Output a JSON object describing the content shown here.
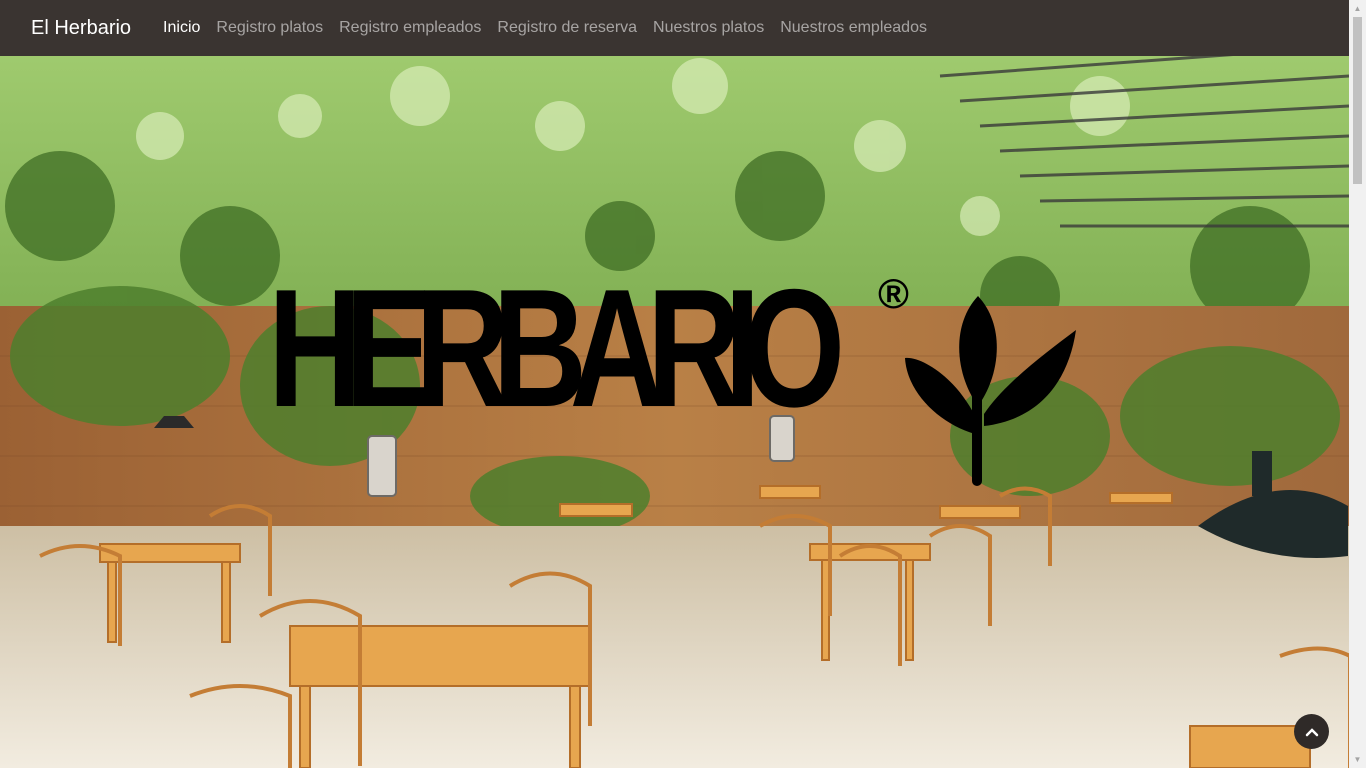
{
  "navbar": {
    "brand": "El Herbario",
    "links": [
      {
        "label": "Inicio",
        "active": true
      },
      {
        "label": "Registro platos",
        "active": false
      },
      {
        "label": "Registro empleados",
        "active": false
      },
      {
        "label": "Registro de reserva",
        "active": false
      },
      {
        "label": "Nuestros platos",
        "active": false
      },
      {
        "label": "Nuestros empleados",
        "active": false
      }
    ]
  },
  "hero": {
    "logo_text": "HERBARIO",
    "logo_mark": "®",
    "logo_icon": "sprout-icon",
    "scene": "garden-terrace-photo"
  },
  "back_to_top": {
    "icon": "chevron-up-icon"
  },
  "colors": {
    "navbar_bg": "#3a3431",
    "nav_active": "#ffffff",
    "nav_inactive": "rgba(255,255,255,0.55)"
  }
}
